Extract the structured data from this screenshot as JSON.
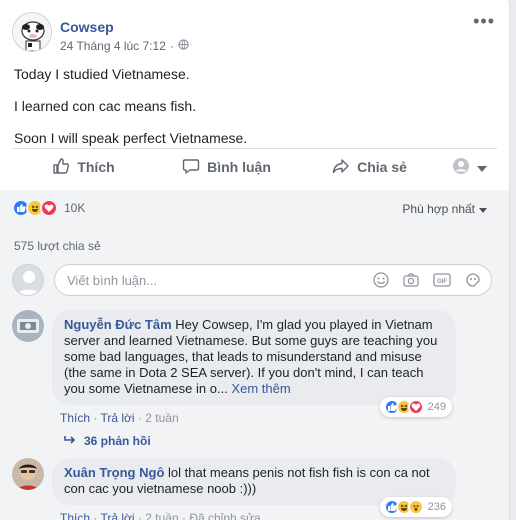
{
  "post": {
    "author": "Cowsep",
    "time": "24 Tháng 4 lúc 7:12",
    "dot": "·",
    "lines": [
      "Today I studied Vietnamese.",
      "I learned con cac means fish.",
      "Soon I will speak perfect Vietnamese."
    ]
  },
  "actions": {
    "like": "Thích",
    "comment": "Bình luận",
    "share": "Chia sẻ"
  },
  "reactions": {
    "count": "10K",
    "filter": "Phù hợp nhất"
  },
  "shares": "575 lượt chia sẻ",
  "composer": {
    "placeholder": "Viết bình luận..."
  },
  "comments": [
    {
      "name": "Nguyễn Đức Tâm",
      "text": "Hey Cowsep, I'm glad you played in Vietnam server and learned Vietnamese. But some guys are teaching you some bad languages, that leads to misunderstand and misuse (the same in Dota 2 SEA server). If you don't mind, I can teach you some Vietnamese in o...",
      "see_more": "Xem thêm",
      "like": "Thích",
      "reply": "Trả lời",
      "time": "2 tuần",
      "reaction_count": "249",
      "replies": "36 phản hồi"
    },
    {
      "name": "Xuân Trọng Ngô",
      "text": "lol that means penis not fish fish is con ca not con cac you vietnamese noob :)))",
      "like": "Thích",
      "reply": "Trả lời",
      "time": "2 tuần",
      "edited": "Đã chỉnh sửa",
      "reaction_count": "236"
    }
  ],
  "colors": {
    "link": "#385898",
    "like_blue": "#2f7af5",
    "love_red": "#f0375a",
    "haha_yellow": "#f8c843",
    "grey_text": "#606770"
  }
}
